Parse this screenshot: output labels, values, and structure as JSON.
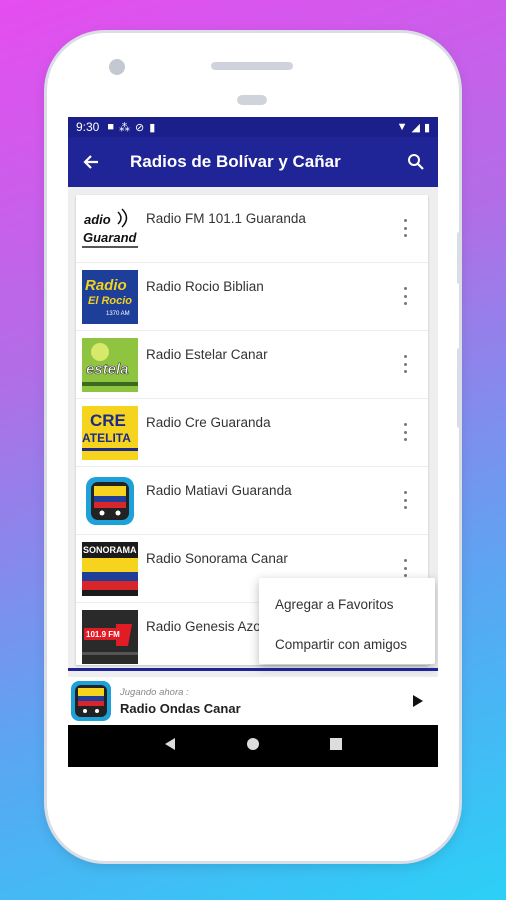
{
  "status": {
    "time": "9:30"
  },
  "appbar": {
    "title": "Radios de Bolívar y Cañar"
  },
  "stations": [
    {
      "name": "Radio FM 101.1 Guaranda"
    },
    {
      "name": "Radio Rocio Biblian"
    },
    {
      "name": "Radio Estelar Canar"
    },
    {
      "name": "Radio Cre Guaranda"
    },
    {
      "name": "Radio Matiavi Guaranda"
    },
    {
      "name": "Radio Sonorama Canar"
    },
    {
      "name": "Radio Genesis Azogues"
    }
  ],
  "menu": {
    "favorites": "Agregar a Favoritos",
    "share": "Compartir con amigos"
  },
  "player": {
    "now_playing_label": "Jugando ahora :",
    "station": "Radio Ondas Canar"
  },
  "colors": {
    "appbar": "#1f2596",
    "statusbar": "#1a1f8c"
  }
}
